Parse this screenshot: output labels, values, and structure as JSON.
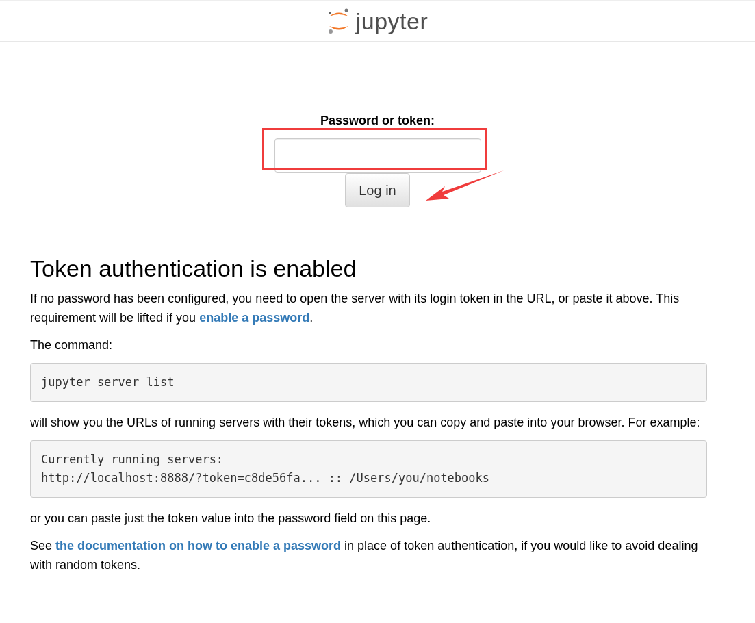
{
  "header": {
    "logo_text": "jupyter"
  },
  "login": {
    "label": "Password or token:",
    "button": "Log in"
  },
  "annotations": {
    "highlight_box": true,
    "pointer_arrow": true
  },
  "info": {
    "heading": "Token authentication is enabled",
    "blocks": [
      {
        "kind": "paragraph",
        "parts": [
          {
            "kind": "text",
            "text": "If no password has been configured, you need to open the server with its login token in the URL, or paste it above. This requirement will be lifted if you "
          },
          {
            "kind": "link",
            "text": "enable a password"
          },
          {
            "kind": "text",
            "text": "."
          }
        ]
      },
      {
        "kind": "paragraph",
        "parts": [
          {
            "kind": "text",
            "text": "The command:"
          }
        ]
      },
      {
        "kind": "code",
        "lines": [
          "jupyter server list"
        ]
      },
      {
        "kind": "paragraph",
        "parts": [
          {
            "kind": "text",
            "text": "will show you the URLs of running servers with their tokens, which you can copy and paste into your browser. For example:"
          }
        ]
      },
      {
        "kind": "code",
        "lines": [
          "Currently running servers:",
          "http://localhost:8888/?token=c8de56fa... :: /Users/you/notebooks"
        ]
      },
      {
        "kind": "paragraph",
        "parts": [
          {
            "kind": "text",
            "text": "or you can paste just the token value into the password field on this page."
          }
        ]
      },
      {
        "kind": "paragraph",
        "parts": [
          {
            "kind": "text",
            "text": "See "
          },
          {
            "kind": "link",
            "text": "the documentation on how to enable a password"
          },
          {
            "kind": "text",
            "text": " in place of token authentication, if you would like to avoid dealing with random tokens."
          }
        ]
      }
    ]
  }
}
